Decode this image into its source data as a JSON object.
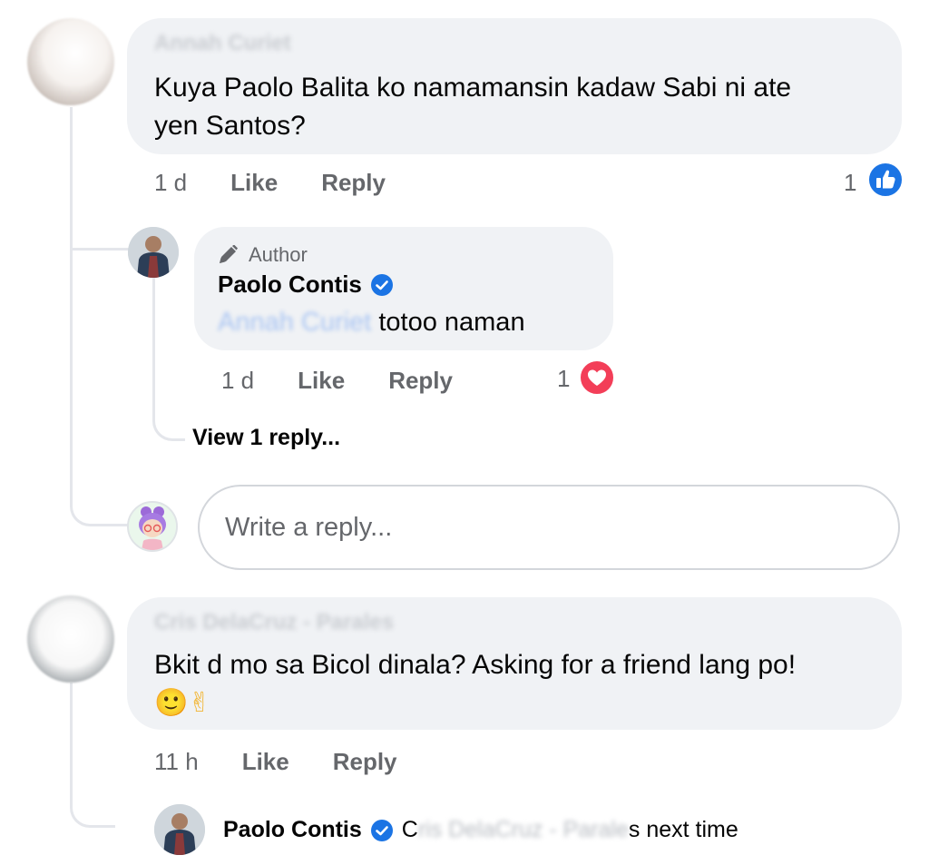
{
  "comment1": {
    "author": "Annah Curiet",
    "text_line1": "Kuya Paolo Balita ko namamansin kadaw Sabi ni ate",
    "text_line2": "yen Santos?",
    "time": "1 d",
    "like_label": "Like",
    "reply_label": "Reply",
    "reaction_count": "1",
    "reaction": "like-icon"
  },
  "reply1": {
    "badge": "Author",
    "author": "Paolo Contis",
    "mention": "Annah Curiet",
    "text": " totoo naman",
    "time": "1 d",
    "like_label": "Like",
    "reply_label": "Reply",
    "reaction_count": "1",
    "reaction": "heart-icon",
    "view_replies": "View 1 reply..."
  },
  "reply_box": {
    "placeholder": "Write a reply..."
  },
  "comment2": {
    "author": "Cris DelaCruz - Parales",
    "text_line1": "Bkit d mo sa Bicol dinala? Asking for a friend lang po!",
    "emojis": "🙂✌",
    "time": "11 h",
    "like_label": "Like",
    "reply_label": "Reply"
  },
  "reply2": {
    "author": "Paolo Contis",
    "mention_prefix": "C",
    "mention": "ris DelaCruz - Parale",
    "text": "s next time"
  },
  "colors": {
    "bubble": "#f0f2f5",
    "secondary_text": "#65676b",
    "like_blue": "#1b74e4",
    "heart_red": "#f33e58"
  }
}
